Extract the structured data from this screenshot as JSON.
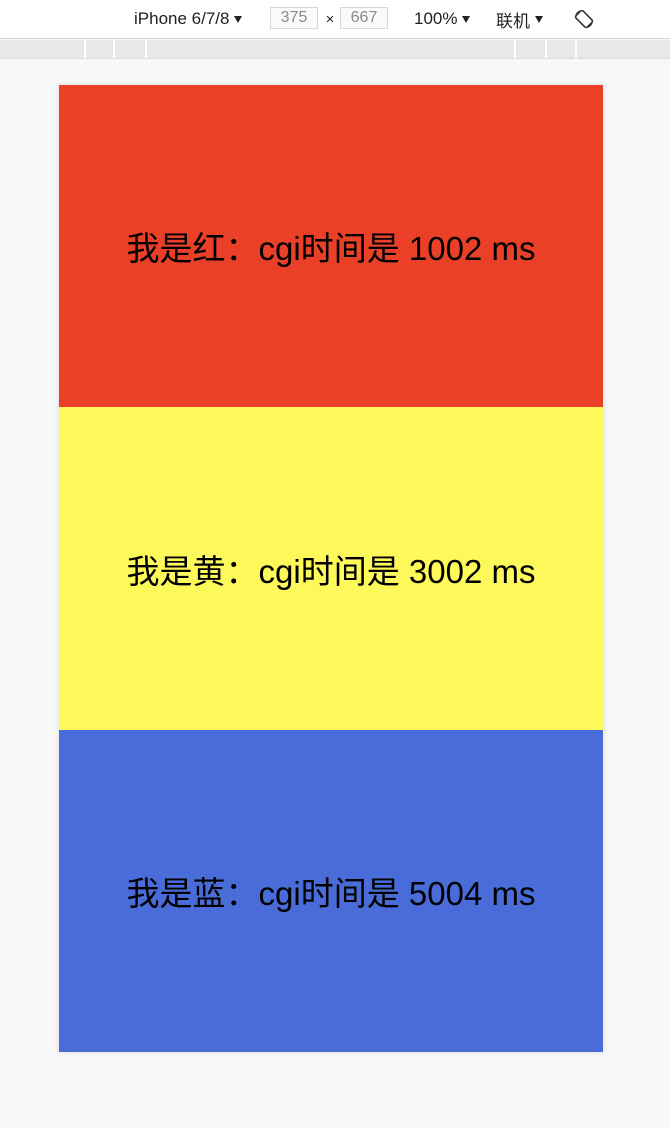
{
  "toolbar": {
    "device": "iPhone 6/7/8",
    "width": "375",
    "times": "×",
    "height": "667",
    "zoom": "100%",
    "network": "联机"
  },
  "blocks": [
    {
      "text": "我是红：cgi时间是 1002 ms",
      "color": "#e94027"
    },
    {
      "text": "我是黄：cgi时间是 3002 ms",
      "color": "#fdf95b"
    },
    {
      "text": "我是蓝：cgi时间是 5004 ms",
      "color": "#496cd9"
    }
  ]
}
